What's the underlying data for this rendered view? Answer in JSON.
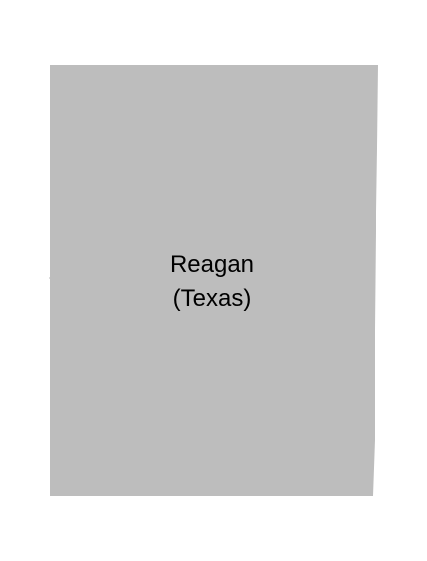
{
  "map": {
    "region": {
      "name": "Reagan",
      "state": "(Texas)",
      "fill_color": "#bdbdbd"
    },
    "background_color": "#ffffff"
  }
}
